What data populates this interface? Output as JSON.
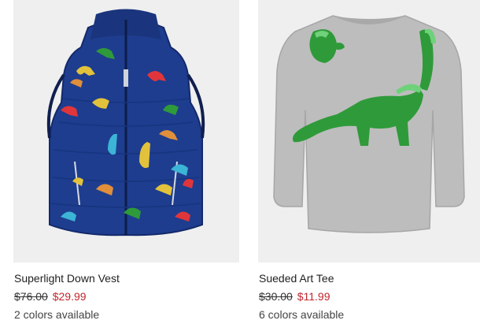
{
  "products": [
    {
      "name": "Superlight Down Vest",
      "original_price": "$76.00",
      "sale_price": "$29.99",
      "colors_text": "2 colors available",
      "image_icon": "dinosaur-print-vest-image"
    },
    {
      "name": "Sueded Art Tee",
      "original_price": "$30.00",
      "sale_price": "$11.99",
      "colors_text": "6 colors available",
      "image_icon": "dinosaur-long-sleeve-tee-image"
    }
  ],
  "colors": {
    "sale": "#c0262d",
    "image_bg": "#efefef",
    "vest": "#1e3d8f",
    "tee": "#b9b9b9",
    "dino_green": "#2f9a3a"
  }
}
